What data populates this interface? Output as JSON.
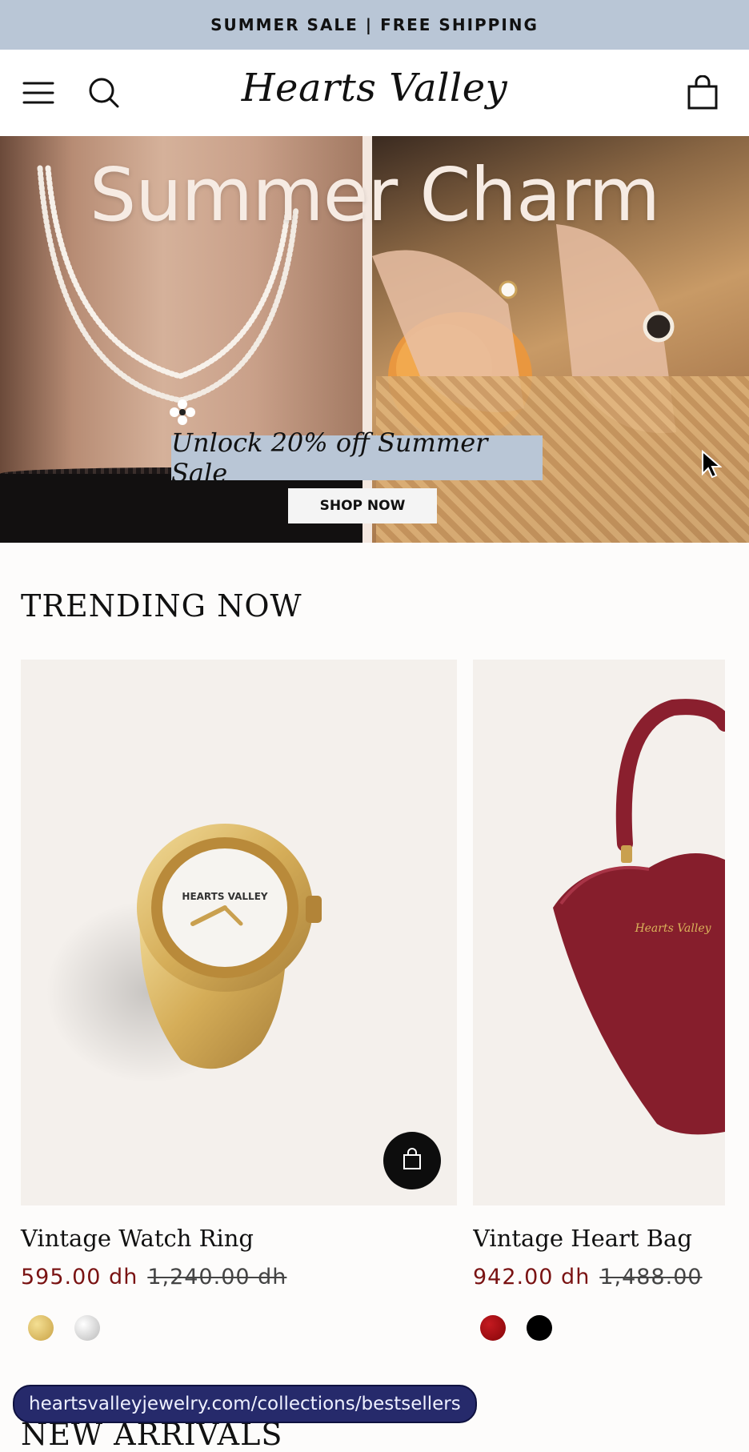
{
  "announcement": "SUMMER SALE | FREE SHIPPING",
  "header": {
    "logo": "Hearts Valley",
    "icons": [
      "menu-icon",
      "search-icon",
      "cart-icon"
    ]
  },
  "hero": {
    "title": "Summer Charm",
    "promo": "Unlock 20% off Summer Sale",
    "button": "SHOP NOW",
    "colors": {
      "promo_bg": "#b9c6d6",
      "button_bg": "#f4f4f4"
    }
  },
  "trending": {
    "title": "TRENDING NOW",
    "products": [
      {
        "name": "Vintage Watch Ring",
        "price": "595.00 dh",
        "compare_price": "1,240.00 dh",
        "swatches": [
          "#d8b65a",
          "#cfcfcf"
        ],
        "quick_add_icon": "shopping-bag-icon"
      },
      {
        "name": "Vintage Heart Bag",
        "price": "942.00 dh",
        "compare_price": "1,488.00",
        "swatches": [
          "#9b0a0e",
          "#000000"
        ]
      }
    ]
  },
  "next_section": {
    "title": "NEW ARRIVALS"
  },
  "status_url": "heartsvalleyjewelry.com/collections/bestsellers",
  "colors": {
    "accent_price": "#7a1313",
    "announce_bg": "#b9c6d6",
    "url_pill_bg": "#262a6b"
  }
}
